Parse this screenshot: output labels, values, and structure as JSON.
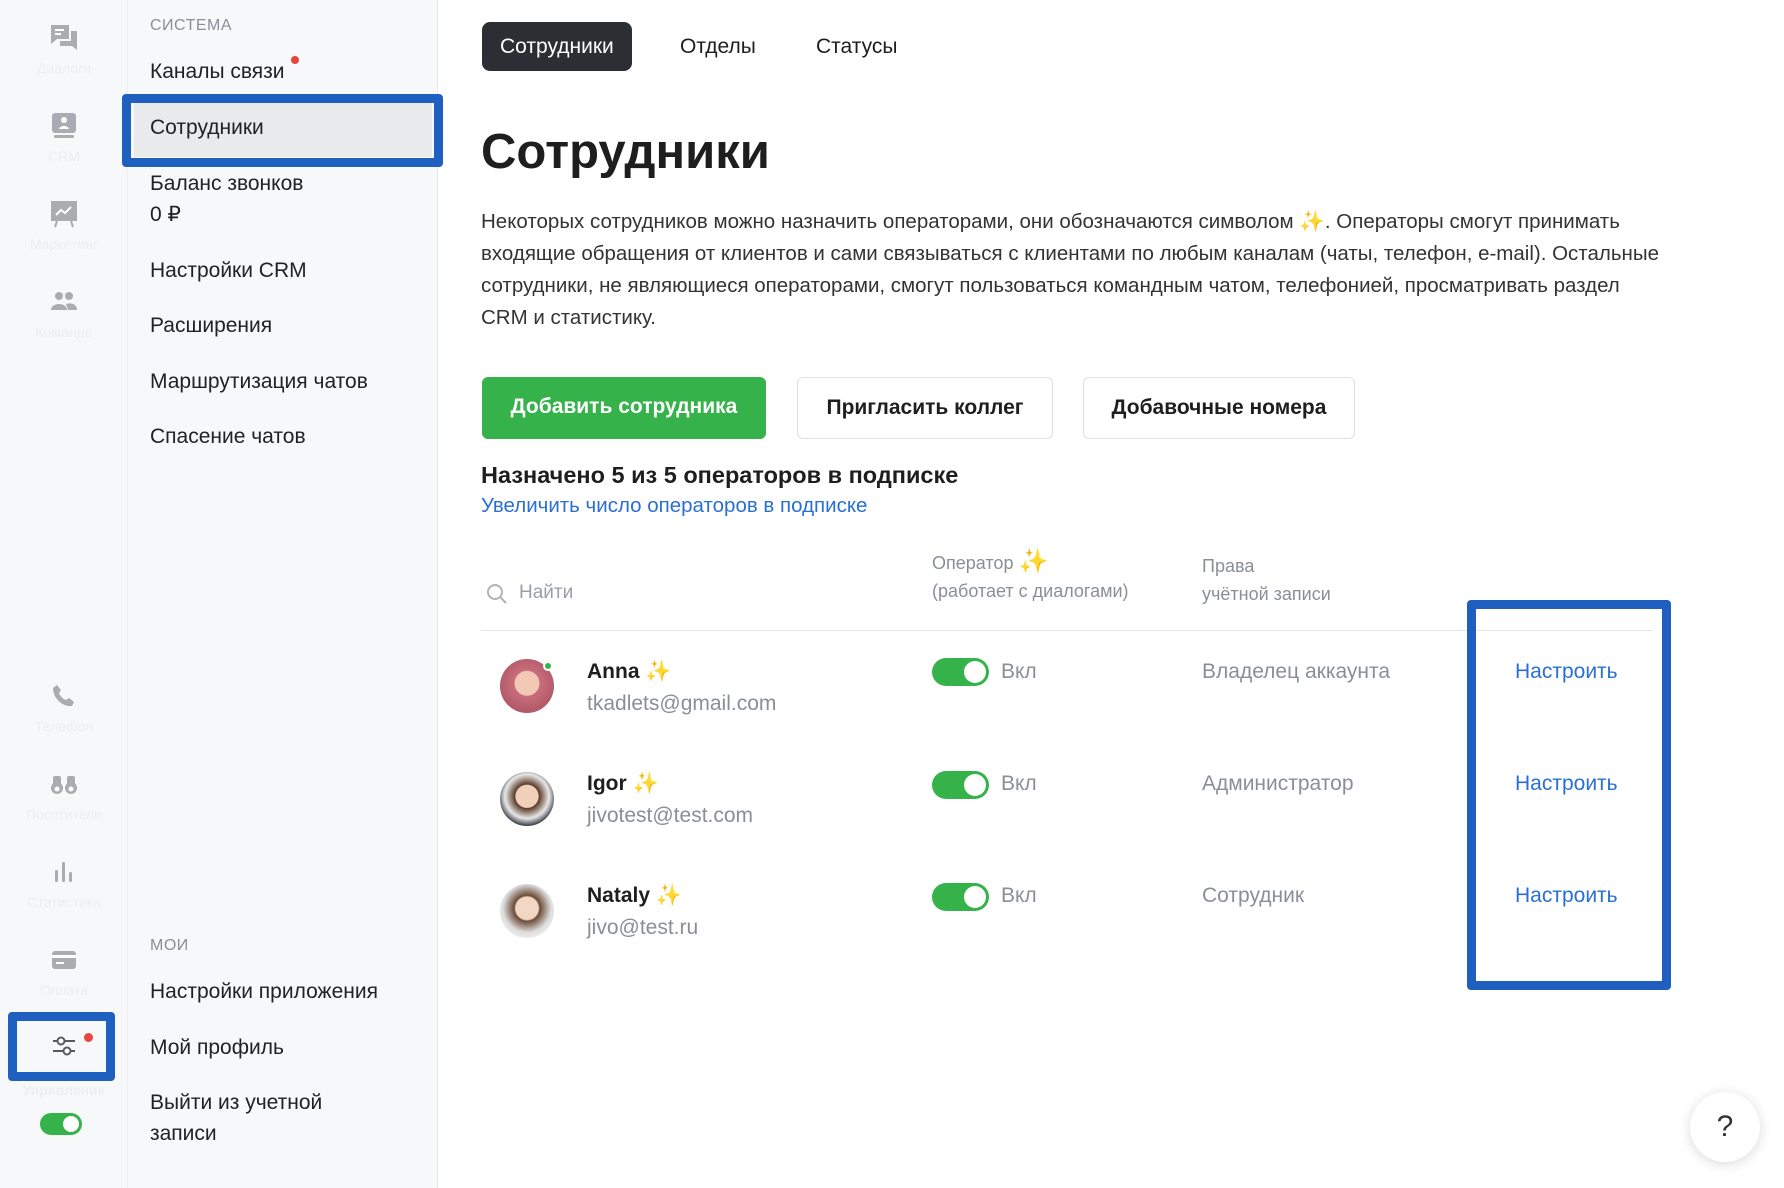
{
  "rail": [
    {
      "label": "Диалоги",
      "icon": "chat-icon"
    },
    {
      "label": "CRM",
      "icon": "crm-icon"
    },
    {
      "label": "Маркетинг",
      "icon": "presentation-chart-icon"
    },
    {
      "label": "Команда",
      "icon": "team-icon"
    },
    {
      "label": "Телефон",
      "icon": "phone-icon"
    },
    {
      "label": "Посетители",
      "icon": "binoculars-icon"
    },
    {
      "label": "Статистика",
      "icon": "bar-chart-icon"
    },
    {
      "label": "Оплата",
      "icon": "credit-card-icon"
    },
    {
      "label": "Управление",
      "icon": "sliders-icon"
    }
  ],
  "sidebar": {
    "system_title": "СИСТЕМА",
    "items": [
      "Каналы связи",
      "Сотрудники",
      "Баланс звонков",
      "0 ₽",
      "Настройки CRM",
      "Расширения",
      "Маршрутизация чатов",
      "Спасение чатов"
    ],
    "my_title": "МОИ",
    "my_items": [
      "Настройки приложения",
      "Мой профиль",
      "Выйти из учетной",
      "записи"
    ]
  },
  "tabs": [
    "Сотрудники",
    "Отделы",
    "Статусы"
  ],
  "title": "Сотрудники",
  "description": {
    "part1": "Некоторых сотрудников можно назначить операторами, они обозначаются символом",
    "part2": ". Операторы смогут принимать входящие обращения от клиентов и сами связываться с клиентами по любым каналам (чаты, телефон, e-mail). Остальные сотрудники, не являющиеся операторами, смогут пользоваться командным чатом, телефонией, просматривать раздел CRM и статистику."
  },
  "buttons": {
    "add": "Добавить сотрудника",
    "invite": "Пригласить коллег",
    "extensions": "Добавочные номера"
  },
  "quota": {
    "text": "Назначено 5 из 5 операторов в подписке",
    "link": "Увеличить число операторов в подписке"
  },
  "table": {
    "search_placeholder": "Найти",
    "col_operator": "Оператор",
    "col_operator_sub": "(работает с диалогами)",
    "col_rights": "Права",
    "col_rights_sub": "учётной записи",
    "rows": [
      {
        "name": "Anna",
        "email": "tkadlets@gmail.com",
        "operator": "Вкл",
        "role": "Владелец аккаунта",
        "action": "Настроить"
      },
      {
        "name": "Igor",
        "email": "jivotest@test.com",
        "operator": "Вкл",
        "role": "Администратор",
        "action": "Настроить"
      },
      {
        "name": "Nataly",
        "email": "jivo@test.ru",
        "operator": "Вкл",
        "role": "Сотрудник",
        "action": "Настроить"
      }
    ]
  },
  "help": "?",
  "colors": {
    "accent_green": "#35b34a",
    "link_blue": "#2a6fd6",
    "highlight": "#1f5fbf",
    "tab_dark": "#2b2f33"
  }
}
